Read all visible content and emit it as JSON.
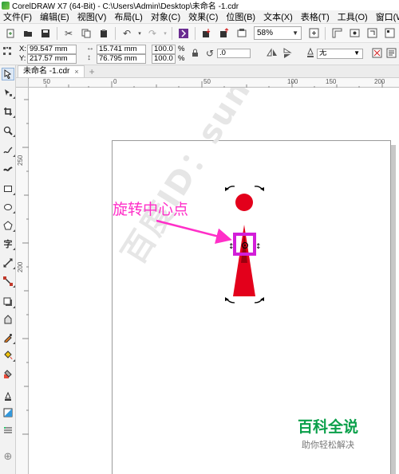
{
  "window": {
    "title": "CorelDRAW X7 (64-Bit) - C:\\Users\\Admin\\Desktop\\未命名 -1.cdr"
  },
  "menu": [
    "文件(F)",
    "编辑(E)",
    "视图(V)",
    "布局(L)",
    "对象(C)",
    "效果(C)",
    "位图(B)",
    "文本(X)",
    "表格(T)",
    "工具(O)",
    "窗口(W)"
  ],
  "toolbar": {
    "zoom": "58%"
  },
  "property_bar": {
    "x_label": "X:",
    "x_value": "99.547 mm",
    "y_label": "Y:",
    "y_value": "217.57 mm",
    "w_value": "15.741 mm",
    "h_value": "76.795 mm",
    "scale_x": "100.0",
    "scale_y": "100.0",
    "percent": "%",
    "rotation": ".0",
    "outline": "无"
  },
  "doc_tab": {
    "label": "未命名 -1.cdr"
  },
  "ruler": {
    "h_labels": [
      "50",
      "0",
      "50",
      "100",
      "150",
      "200"
    ],
    "v_labels": [
      "250",
      "200"
    ]
  },
  "canvas": {
    "annotation": "旋转中心点",
    "watermark": "百度ID：sunnyMelody夏",
    "brand_title": "百科全说",
    "brand_subtitle": "助你轻松解决"
  },
  "colors": {
    "shape_red": "#e3001b",
    "annotation_magenta": "#ff2fc8",
    "center_highlight": "#d21ed8",
    "brand_green": "#0aa04a"
  }
}
